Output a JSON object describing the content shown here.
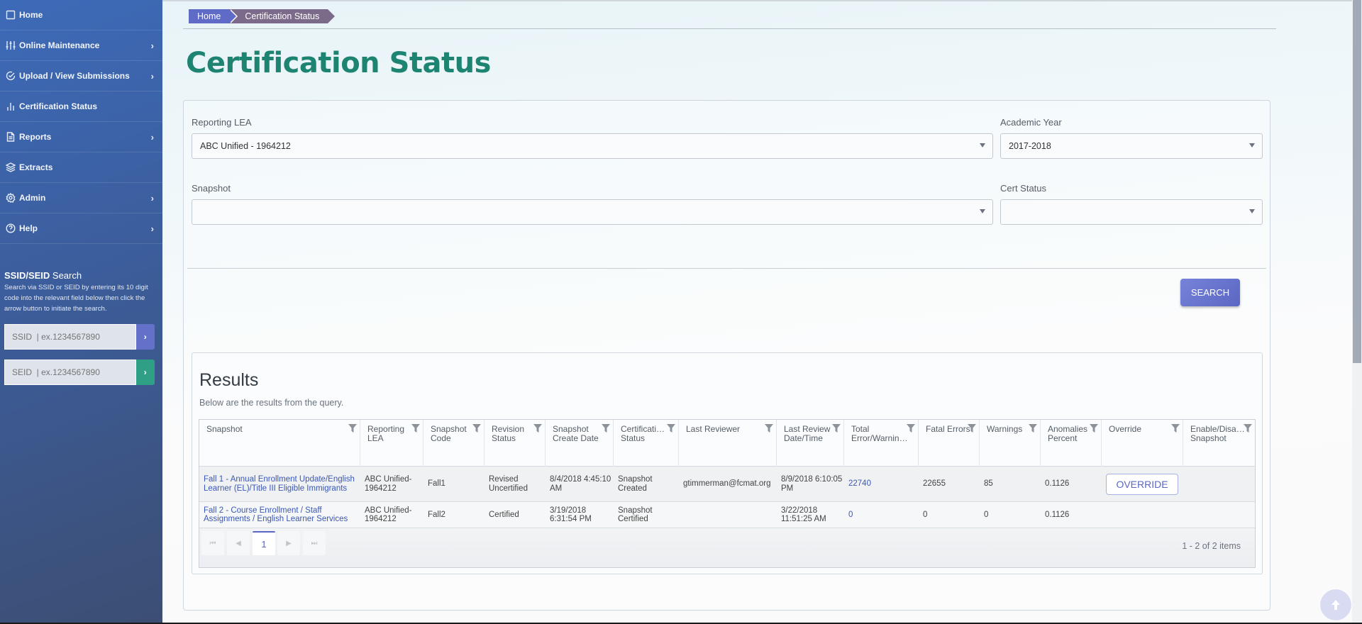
{
  "sidebar": {
    "items": [
      {
        "label": "Home",
        "icon": "square-icon",
        "has_submenu": false
      },
      {
        "label": "Online Maintenance",
        "icon": "sliders-icon",
        "has_submenu": true
      },
      {
        "label": "Upload / View Submissions",
        "icon": "check-circle-icon",
        "has_submenu": true
      },
      {
        "label": "Certification Status",
        "icon": "bar-chart-icon",
        "has_submenu": false
      },
      {
        "label": "Reports",
        "icon": "document-icon",
        "has_submenu": true
      },
      {
        "label": "Extracts",
        "icon": "layers-icon",
        "has_submenu": false
      },
      {
        "label": "Admin",
        "icon": "gear-icon",
        "has_submenu": true
      },
      {
        "label": "Help",
        "icon": "help-circle-icon",
        "has_submenu": true
      }
    ],
    "search": {
      "title_bold": "SSID/SEID",
      "title_rest": " Search",
      "description": "Search via SSID or SEID by entering its 10 digit code into the relevant field below then click the arrow button to initiate the search.",
      "ssid_placeholder": "SSID  | ex.1234567890",
      "seid_placeholder": "SEID  | ex.1234567890",
      "go_glyph": "›",
      "ssid_color": "#6471c9",
      "seid_color": "#2f9f86"
    }
  },
  "breadcrumb": [
    "Home",
    "Certification Status"
  ],
  "page_title": "Certification Status",
  "filters": {
    "reporting_lea": {
      "label": "Reporting LEA",
      "value": "ABC Unified - 1964212"
    },
    "academic_year": {
      "label": "Academic Year",
      "value": "2017-2018"
    },
    "snapshot": {
      "label": "Snapshot",
      "value": ""
    },
    "cert_status": {
      "label": "Cert Status",
      "value": ""
    },
    "search_label": "SEARCH"
  },
  "results": {
    "title": "Results",
    "subtitle": "Below are the results from the query.",
    "columns": [
      "Snapshot",
      "Reporting LEA",
      "Snapshot Code",
      "Revision Status",
      "Snapshot Create Date",
      "Certificati… Status",
      "Last Reviewer",
      "Last Review Date/Time",
      "Total Error/Warnin…",
      "Fatal Errors",
      "Warnings",
      "Anomalies Percent",
      "Override",
      "Enable/Disa… Snapshot"
    ],
    "rows": [
      {
        "snapshot": "Fall 1 - Annual Enrollment Update/English Learner (EL)/Title III Eligible Immigrants",
        "reporting_lea": "ABC Unified-1964212",
        "snapshot_code": "Fall1",
        "revision_status": "Revised Uncertified",
        "create_date": "8/4/2018 4:45:10 AM",
        "cert_status": "Snapshot Created",
        "last_reviewer": "gtimmerman@fcmat.org",
        "last_review": "8/9/2018 6:10:05 PM",
        "total": "22740",
        "fatal": "22655",
        "warnings": "85",
        "anomalies": "0.1126",
        "override": "OVERRIDE",
        "enable": ""
      },
      {
        "snapshot": "Fall 2 - Course Enrollment / Staff Assignments / English Learner Services",
        "reporting_lea": "ABC Unified-1964212",
        "snapshot_code": "Fall2",
        "revision_status": "Certified",
        "create_date": "3/19/2018 6:31:54 PM",
        "cert_status": "Snapshot Certified",
        "last_reviewer": "",
        "last_review": "3/22/2018 11:51:25 AM",
        "total": "0",
        "fatal": "0",
        "warnings": "0",
        "anomalies": "0.1126",
        "override": "",
        "enable": ""
      }
    ],
    "pager": {
      "current_page": "1",
      "info": "1 - 2 of 2 items",
      "first": "⏮",
      "prev": "◀",
      "next": "▶",
      "last": "⏭"
    }
  },
  "colors": {
    "title": "#1e8472",
    "accent": "#5f6bc7",
    "link": "#3a57b5"
  }
}
